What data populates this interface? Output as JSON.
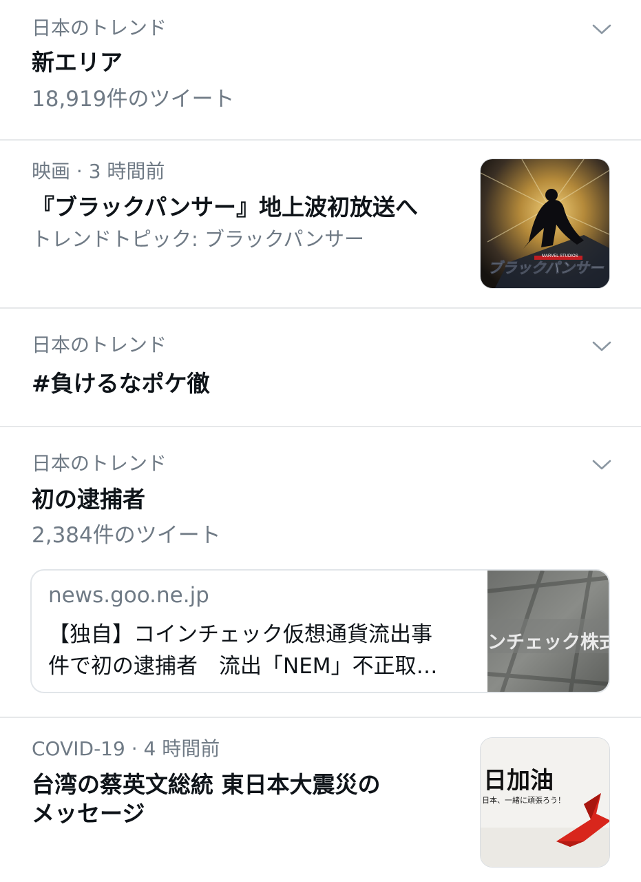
{
  "trends": [
    {
      "meta": "日本のトレンド",
      "title": "新エリア",
      "tweets": "18,919件のツイート"
    },
    {
      "meta": "映画 · 3 時間前",
      "title": "『ブラックパンサー』地上波初放送へ",
      "sub": "トレンドトピック: ブラックパンサー",
      "thumb_icon": "black-panther-poster",
      "thumb_caption": "ブラックパンサー",
      "thumb_brand": "MARVEL STUDIOS"
    },
    {
      "meta": "日本のトレンド",
      "title": "#負けるなポケ徹"
    },
    {
      "meta": "日本のトレンド",
      "title": "初の逮捕者",
      "tweets": "2,384件のツイート",
      "card": {
        "domain": "news.goo.ne.jp",
        "line1": "【独自】コインチェック仮想通貨流出事",
        "line2": "件で初の逮捕者　流出「NEM」不正取…",
        "image_text": "ンチェック株式"
      }
    },
    {
      "meta": "COVID-19 · 4 時間前",
      "title_line1": "台湾の蔡英文総統 東日本大震災の",
      "title_line2": "メッセージ",
      "thumb_icon": "paper-crane-image",
      "thumb_title": "日加油",
      "thumb_sub": "日本、一緒に頑張ろう！"
    }
  ],
  "colors": {
    "secondary_text": "#6f7a85",
    "divider": "#e6e8ea",
    "crane_red": "#d8261c"
  }
}
